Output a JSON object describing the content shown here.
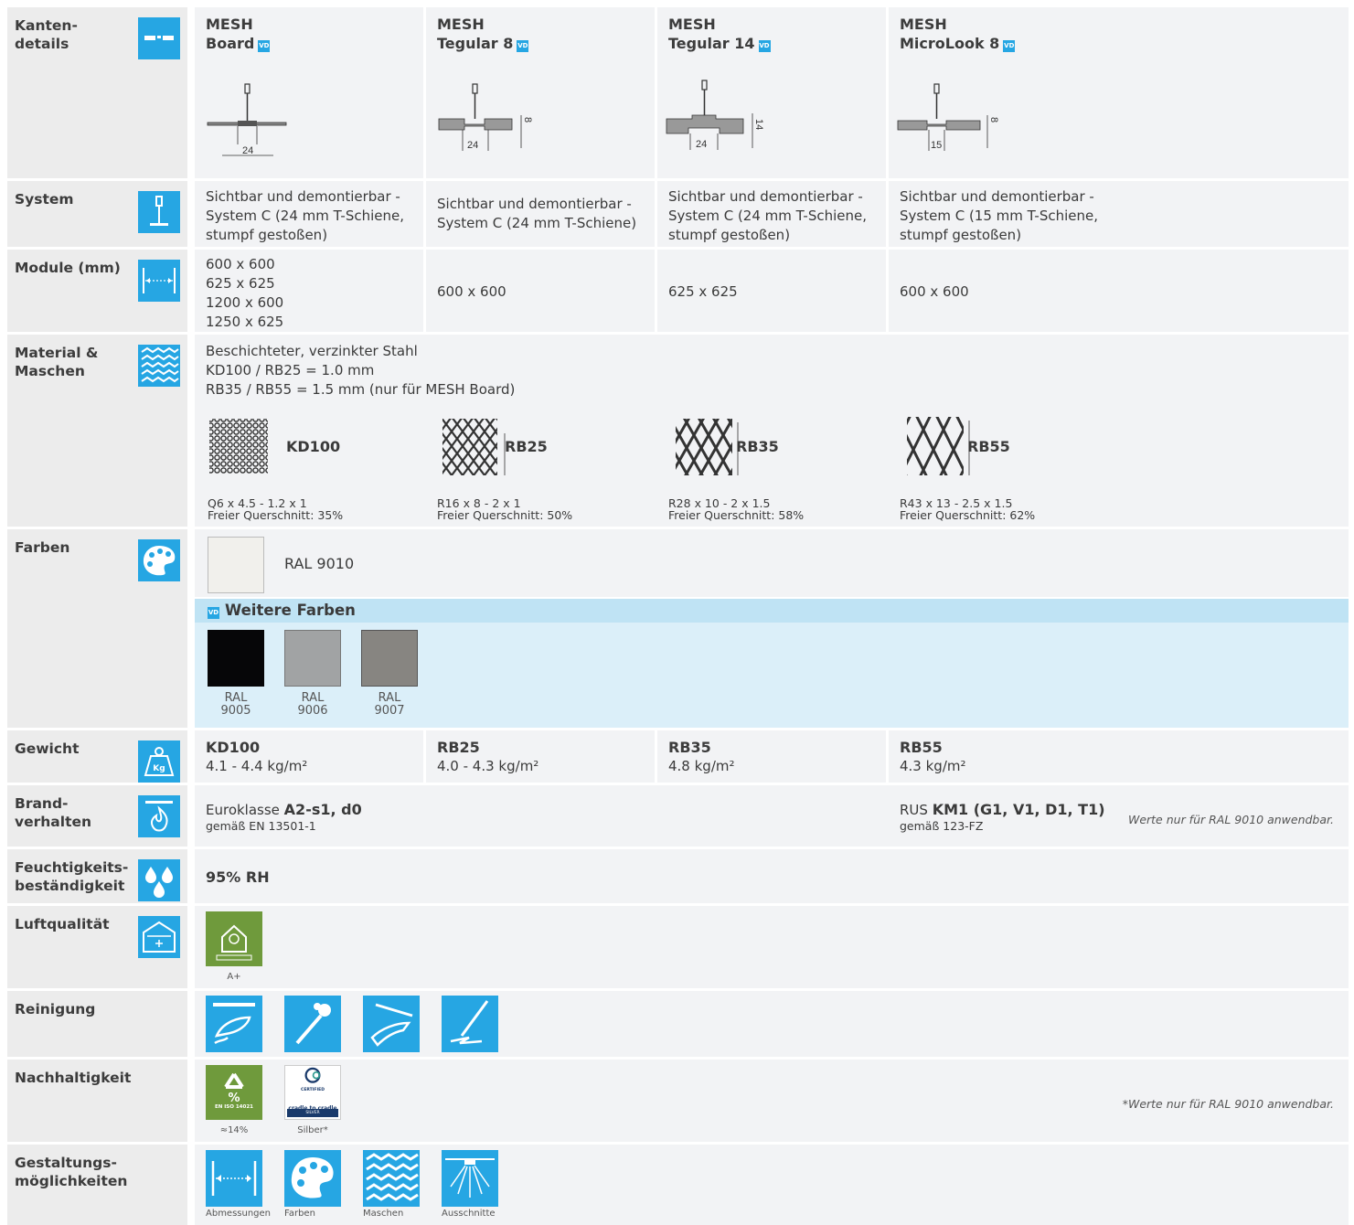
{
  "rows": {
    "kanten": {
      "label": "Kanten-\ndetails"
    },
    "system": {
      "label": "System"
    },
    "module": {
      "label": "Module (mm)"
    },
    "material": {
      "label": "Material &\nMaschen"
    },
    "farben": {
      "label": "Farben"
    },
    "gewicht": {
      "label": "Gewicht"
    },
    "brand": {
      "label": "Brand-\nverhalten"
    },
    "feuchte": {
      "label": "Feuchtigkeits-\nbeständigkeit"
    },
    "luft": {
      "label": "Luftqualität"
    },
    "reinigung": {
      "label": "Reinigung"
    },
    "nachhaltig": {
      "label": "Nachhaltigkeit"
    },
    "gestaltung": {
      "label": "Gestaltungs-\nmöglichkeiten"
    }
  },
  "vd_badge": "VD",
  "products": [
    {
      "line1": "MESH",
      "line2": "Board",
      "dim": "24",
      "system": "Sichtbar und demontierbar - System C (24 mm T-Schiene, stumpf gestoßen)",
      "module": "600 x 600\n625 x 625\n1200 x 600\n1250 x 625"
    },
    {
      "line1": "MESH",
      "line2": "Tegular 8",
      "dim": "24",
      "dim2": "8",
      "system": "Sichtbar und demontierbar - System C (24 mm T-Schiene)",
      "module": "600 x 600"
    },
    {
      "line1": "MESH",
      "line2": "Tegular 14",
      "dim": "24",
      "dim2": "14",
      "system": "Sichtbar und demontierbar - System C (24 mm T-Schiene, stumpf gestoßen)",
      "module": "625 x 625"
    },
    {
      "line1": "MESH",
      "line2": "MicroLook 8",
      "dim": "15",
      "dim2": "8",
      "system": "Sichtbar und demontierbar - System C (15 mm T-Schiene, stumpf gestoßen)",
      "module": "600 x 600"
    }
  ],
  "material": {
    "text": "Beschichteter, verzinkter Stahl\nKD100 / RB25 = 1.0 mm\nRB35 / RB55 = 1.5 mm (nur für MESH Board)",
    "meshes": [
      {
        "name": "KD100",
        "spec": "Q6 x 4.5 - 1.2 x 1",
        "free": "Freier Querschnitt: 35%"
      },
      {
        "name": "RB25",
        "spec": "R16 x 8 - 2 x 1",
        "free": "Freier Querschnitt: 50%"
      },
      {
        "name": "RB35",
        "spec": "R28 x 10 - 2 x 1.5",
        "free": "Freier Querschnitt: 58%"
      },
      {
        "name": "RB55",
        "spec": "R43 x 13 - 2.5 x 1.5",
        "free": "Freier Querschnitt: 62%"
      }
    ]
  },
  "farben": {
    "standard": {
      "name": "RAL 9010",
      "color": "#f1f0ec"
    },
    "weitere_title": "Weitere Farben",
    "weitere": [
      {
        "l1": "RAL",
        "l2": "9005",
        "color": "#060608"
      },
      {
        "l1": "RAL",
        "l2": "9006",
        "color": "#a1a3a4"
      },
      {
        "l1": "RAL",
        "l2": "9007",
        "color": "#878581"
      }
    ]
  },
  "gewicht": [
    {
      "name": "KD100",
      "value": "4.1 - 4.4 kg/m²"
    },
    {
      "name": "RB25",
      "value": "4.0 - 4.3 kg/m²"
    },
    {
      "name": "RB35",
      "value": "4.8 kg/m²"
    },
    {
      "name": "RB55",
      "value": "4.3 kg/m²"
    }
  ],
  "brand": {
    "left_prefix": "Euroklasse ",
    "left_bold": "A2-s1, d0",
    "left_sub": "gemäß EN 13501-1",
    "right_prefix": "RUS ",
    "right_bold": "KM1 (G1, V1, D1, T1)",
    "right_sub": "gemäß 123-FZ",
    "note": "Werte nur für RAL 9010 anwendbar."
  },
  "feuchte": {
    "value": "95% RH"
  },
  "luft": {
    "caption": "A+"
  },
  "nachhaltig": {
    "recycle_caption": "≈14%",
    "recycle_label": "EN ISO 14021",
    "c2c_caption": "Silber*",
    "c2c_label1": "CERTIFIED",
    "c2c_label2": "cradle to cradle",
    "c2c_label3": "SILVER",
    "note": "*Werte nur für RAL 9010 anwendbar."
  },
  "gestaltung": [
    "Abmessungen",
    "Farben",
    "Maschen",
    "Ausschnitte"
  ],
  "colors": {
    "accent": "#26a6e3",
    "label_bg": "#ececec",
    "content_bg": "#f2f3f5",
    "weitere_bg": "#dbeff9",
    "weitere_head": "#bfe3f4",
    "luft_green": "#6f9a3c",
    "c2c_blue": "#1a3a6b"
  }
}
